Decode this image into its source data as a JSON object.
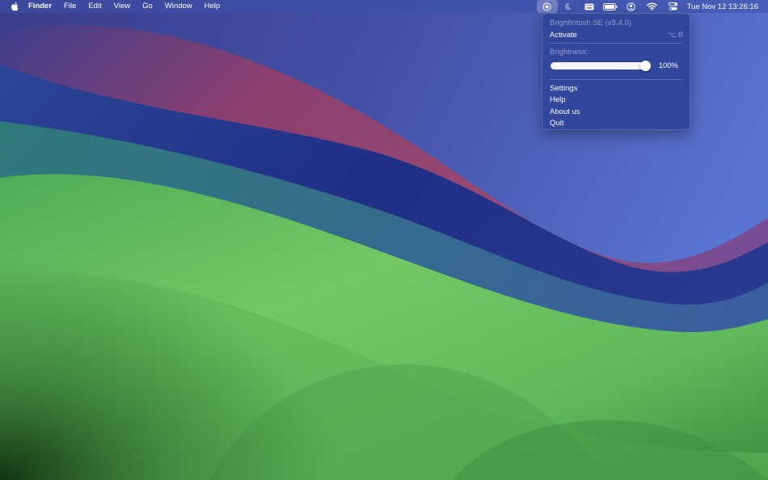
{
  "menubar": {
    "app_name": "Finder",
    "menus": [
      "File",
      "Edit",
      "View",
      "Go",
      "Window",
      "Help"
    ],
    "status_icons": [
      "brightintosh-icon",
      "moon-icon",
      "keyboard-icon",
      "battery-icon",
      "user-icon",
      "wifi-icon",
      "control-center-icon"
    ],
    "clock": "Tue Nov 12  13:26:16"
  },
  "dropdown": {
    "header": "BrightIntosh SE (v3.4.0)",
    "activate_label": "Activate",
    "activate_shortcut": "⌥ B",
    "brightness_label": "Brightness:",
    "brightness_value_text": "100%",
    "brightness_fraction": 1.0,
    "items": [
      "Settings",
      "Help",
      "About us",
      "Quit"
    ]
  },
  "colors": {
    "menubar_bg": "#4a5cb0",
    "menu_bg": "#304498",
    "sky_top": "#3a3f8f",
    "wave_red": "#8a3f6e",
    "wave_blue": "#22348a",
    "hill_green": "#6cc45e",
    "deep_green": "#1e4a1c"
  }
}
